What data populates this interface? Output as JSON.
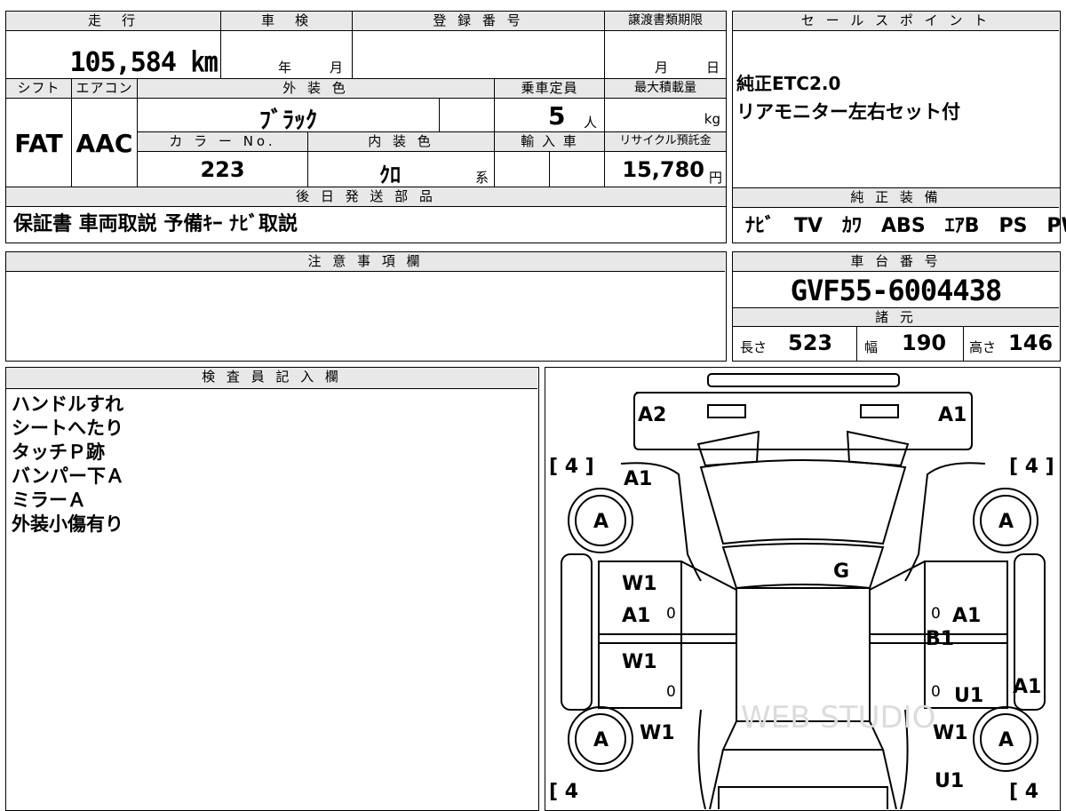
{
  "top_info": {
    "headers": {
      "mileage": "走　行",
      "shaken": "車　検",
      "reg_no": "登 録 番 号",
      "transfer_deadline": "譲渡書類期限"
    },
    "mileage": "105,584 ㎞",
    "shaken_year": "年",
    "shaken_month": "月",
    "transfer_month": "月",
    "transfer_day": "日",
    "row2_headers": {
      "shift": "シフト",
      "ac": "エアコン",
      "ext_color": "外 装 色",
      "capacity": "乗車定員",
      "max_load": "最大積載量"
    },
    "shift": "FAT",
    "ac": "AAC",
    "ext_color": "ﾌﾞﾗｯｸ",
    "capacity": "5",
    "capacity_unit": "人",
    "max_load_unit": "kg",
    "row3_headers": {
      "color_no": "カ ラ ー No.",
      "int_color": "内 装 色",
      "import": "輸 入 車",
      "recycle": "リサイクル預託金"
    },
    "color_no": "223",
    "int_color": "ｸﾛ",
    "int_color_suffix": "系",
    "recycle_fee": "15,780",
    "recycle_unit": "円",
    "parts_header": "後 日 発 送 部 品",
    "parts": "保証書 車両取説 予備ｷｰ ﾅﾋﾞ取説"
  },
  "sales_point": {
    "header": "セ ー ル ス ポ イ ン ト",
    "lines": [
      "純正ETC2.0",
      "リアモニター左右セット付"
    ]
  },
  "equipment": {
    "header": "純 正 装 備",
    "items": "ﾅﾋﾞ　TV　ｶﾜ　ABS　ｴｱB　PS　PW"
  },
  "notes": {
    "header": "注 意 事 項 欄",
    "text": ""
  },
  "chassis": {
    "header": "車 台 番 号",
    "number": "GVF55-6004438",
    "specs_header": "諸 元",
    "length_label": "長さ",
    "length": "523",
    "width_label": "幅",
    "width": "190",
    "height_label": "高さ",
    "height": "146"
  },
  "inspector": {
    "header": "検 査 員 記 入 欄",
    "lines": [
      "ハンドルすれ",
      "シートへたり",
      "タッチＰ跡",
      "バンパー下Ａ",
      "ミラーＡ",
      "外装小傷有り"
    ]
  },
  "diagram": {
    "marks": {
      "front_left": "A2",
      "front_right": "A1",
      "hood_left": "A1",
      "tire_fl": "A",
      "tire_fr": "A",
      "tire_rl": "A",
      "tire_rr": "A",
      "bracket_tl": "[ 4 ]",
      "bracket_tr": "[ 4 ]",
      "bracket_bl": "[ 4",
      "bracket_br": "[ 4",
      "roof": "G",
      "door_fl_1": "W1",
      "door_fl_2": "A1",
      "door_rl": "W1",
      "door_fr": "A1",
      "pillar_r": "B1",
      "door_rr": "U1",
      "side_r": "A1",
      "rear_left": "W1",
      "rear_right": "W1",
      "rear_bottom_right": "U1",
      "zero": "0"
    },
    "watermark": "WEB STUDIO"
  }
}
